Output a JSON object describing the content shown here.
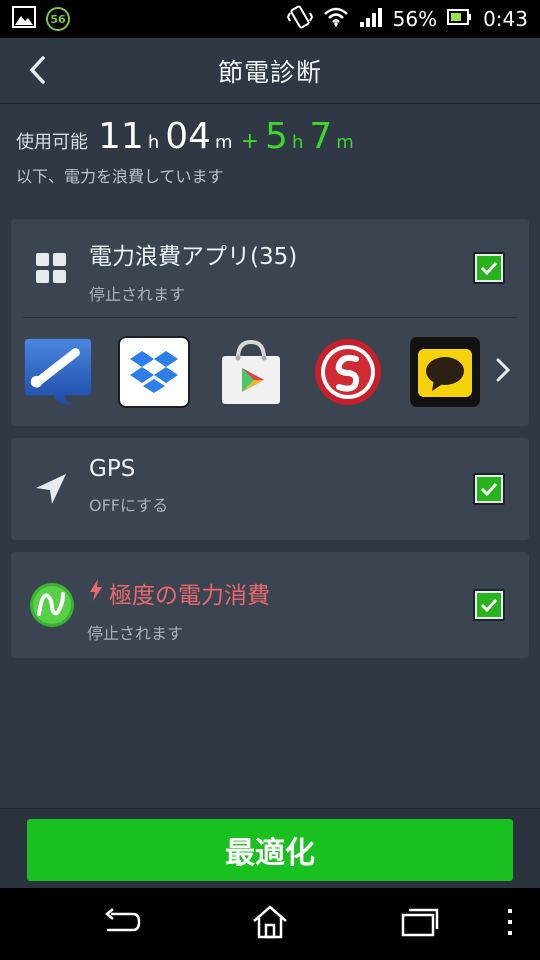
{
  "statusbar": {
    "badge": "56",
    "battery_percent": "56%",
    "time": "0:43"
  },
  "header": {
    "title": "節電診断",
    "back_icon": "chevron-left-icon"
  },
  "summary": {
    "label": "使用可能",
    "hours": "11",
    "hours_unit": "h",
    "minutes": "04",
    "minutes_unit": "m",
    "plus": "+",
    "extra_hours": "5",
    "extra_hours_unit": "h",
    "extra_minutes": "7",
    "extra_minutes_unit": "m",
    "subtitle": "以下、電力を浪費しています"
  },
  "cards": {
    "apps": {
      "title": "電力浪費アプリ(35)",
      "subtitle": "停止されます",
      "checked": true,
      "icons": [
        "baseball-app-icon",
        "dropbox-icon",
        "play-store-icon",
        "snapdragon-icon",
        "sony-chat-icon"
      ]
    },
    "gps": {
      "title": "GPS",
      "subtitle": "OFFにする",
      "checked": true
    },
    "extreme": {
      "title": "極度の電力消費",
      "subtitle": "停止されます",
      "checked": true
    }
  },
  "colors": {
    "accent_green": "#3cd52c",
    "button_green": "#18c11f",
    "danger_red": "#e9676b",
    "background": "#2f3844",
    "card": "#3b4552"
  },
  "action": {
    "optimize_label": "最適化"
  }
}
